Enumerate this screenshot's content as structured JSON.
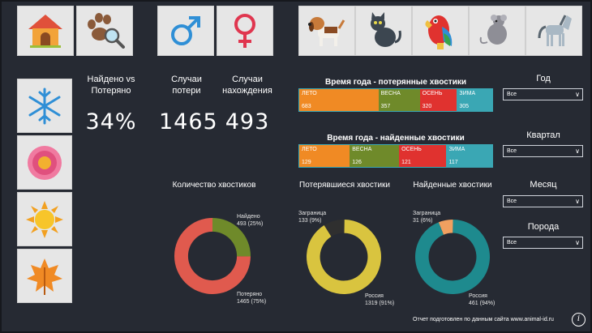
{
  "kpis": {
    "found_vs_lost_label": "Найдено vs Потеряно",
    "found_vs_lost_value": "34%",
    "lost_cases_label": "Случаи потери",
    "lost_cases_value": "1465",
    "found_cases_label": "Случаи нахождения",
    "found_cases_value": "493"
  },
  "icons": {
    "top_left": [
      "doghouse-icon",
      "paw-search-icon"
    ],
    "gender": [
      "male-icon",
      "female-icon"
    ],
    "animals": [
      "dog-icon",
      "cat-icon",
      "parrot-icon",
      "rat-icon",
      "horse-icon"
    ],
    "seasons": [
      "snowflake-icon",
      "flower-icon",
      "sun-icon",
      "autumn-leaf-icon"
    ]
  },
  "lost_seasons": {
    "title": "Время года - потерянные хвостики",
    "segments": [
      {
        "name": "ЛЕТО",
        "value": 683,
        "color": "#f08a24"
      },
      {
        "name": "ВЕСНА",
        "value": 357,
        "color": "#6f8a2a"
      },
      {
        "name": "ОСЕНЬ",
        "value": 320,
        "color": "#e0322f"
      },
      {
        "name": "ЗИМА",
        "value": 305,
        "color": "#3aa7b4"
      }
    ]
  },
  "found_seasons": {
    "title": "Время года - найденные хвостики",
    "segments": [
      {
        "name": "ЛЕТО",
        "value": 129,
        "color": "#f08a24"
      },
      {
        "name": "ВЕСНА",
        "value": 126,
        "color": "#6f8a2a"
      },
      {
        "name": "ОСЕНЬ",
        "value": 121,
        "color": "#e0322f"
      },
      {
        "name": "ЗИМА",
        "value": 117,
        "color": "#3aa7b4"
      }
    ]
  },
  "donuts": {
    "count": {
      "title": "Количество хвостиков",
      "slices": [
        {
          "name": "Найдено",
          "value": 493,
          "label": "493 (25%)",
          "color": "#6f8a2a"
        },
        {
          "name": "Потеряно",
          "value": 1465,
          "label": "1465 (75%)",
          "color": "#e05a4e"
        }
      ]
    },
    "lost": {
      "title": "Потерявшиеся хвостики",
      "slices": [
        {
          "name": "Заграница",
          "value": 133,
          "label": "133 (9%)",
          "color": "#2f2f2f"
        },
        {
          "name": "Россия",
          "value": 1319,
          "label": "1319 (91%)",
          "color": "#d9c43f"
        }
      ]
    },
    "found": {
      "title": "Найденные хвостики",
      "slices": [
        {
          "name": "Заграница",
          "value": 31,
          "label": "31 (6%)",
          "color": "#f0a060"
        },
        {
          "name": "Россия",
          "value": 461,
          "label": "461 (94%)",
          "color": "#1e8a8e"
        }
      ]
    }
  },
  "filters": {
    "year": {
      "label": "Год",
      "value": "Все"
    },
    "quarter": {
      "label": "Квартал",
      "value": "Все"
    },
    "month": {
      "label": "Месяц",
      "value": "Все"
    },
    "breed": {
      "label": "Порода",
      "value": "Все"
    }
  },
  "footer": {
    "text": "Отчет подготовлен по данным сайта www.animal-id.ru",
    "info_glyph": "i"
  }
}
